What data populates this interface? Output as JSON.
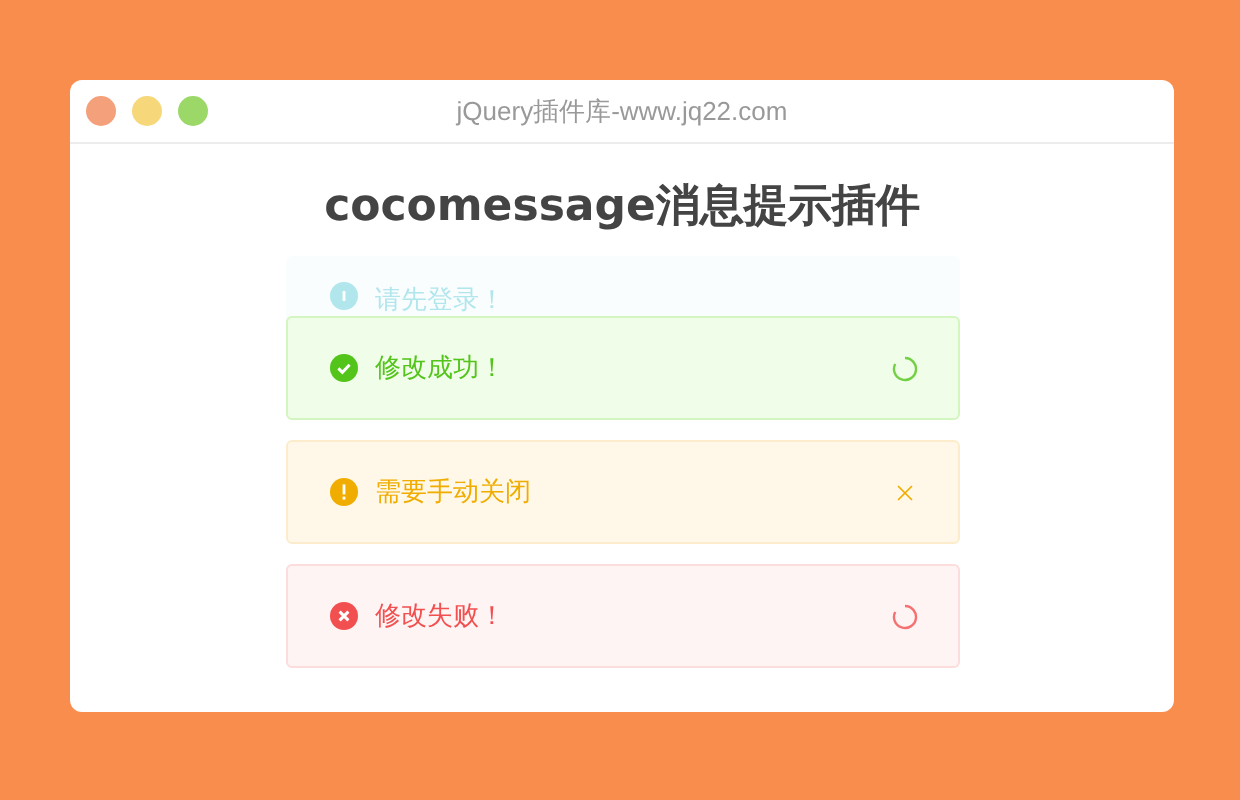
{
  "window": {
    "title": "jQuery插件库-www.jq22.com"
  },
  "heading": "cocomessage消息提示插件",
  "messages": [
    {
      "kind": "info",
      "text": "请先登录！",
      "leaving": true
    },
    {
      "kind": "success",
      "text": "修改成功！",
      "leaving": false,
      "closable": false
    },
    {
      "kind": "warning",
      "text": "需要手动关闭",
      "leaving": false,
      "closable": true
    },
    {
      "kind": "error",
      "text": "修改失败！",
      "leaving": false,
      "closable": false
    }
  ]
}
